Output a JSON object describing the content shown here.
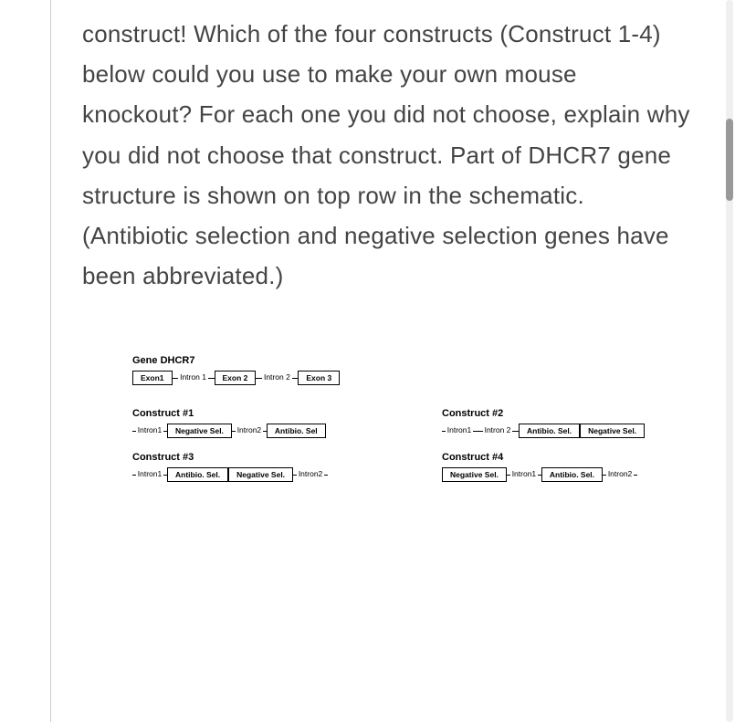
{
  "question": "construct!  Which of the four constructs (Construct 1-4) below could you use to make your own mouse knockout?  For each one you did not choose, explain why you did not choose that construct.  Part of DHCR7 gene structure is shown on top row in the schematic. (Antibiotic selection and negative selection genes have been abbreviated.)",
  "gene": {
    "title": "Gene DHCR7",
    "segments": [
      {
        "type": "exon",
        "label": "Exon1"
      },
      {
        "type": "intron",
        "label": "Intron 1"
      },
      {
        "type": "exon",
        "label": "Exon 2"
      },
      {
        "type": "intron",
        "label": "Intron 2"
      },
      {
        "type": "exon",
        "label": "Exon 3"
      }
    ]
  },
  "constructs": [
    {
      "title": "Construct #1",
      "segments": [
        {
          "type": "intron",
          "label": "Intron1"
        },
        {
          "type": "exon",
          "label": "Negative Sel."
        },
        {
          "type": "intron",
          "label": "Intron2"
        },
        {
          "type": "exon",
          "label": "Antibio. Sel"
        }
      ]
    },
    {
      "title": "Construct #2",
      "segments": [
        {
          "type": "intron",
          "label": "Intron1"
        },
        {
          "type": "intron",
          "label": "Intron 2"
        },
        {
          "type": "exon",
          "label": "Antibio. Sel."
        },
        {
          "type": "exon",
          "label": "Negative Sel."
        }
      ]
    },
    {
      "title": "Construct #3",
      "segments": [
        {
          "type": "intron",
          "label": "Intron1"
        },
        {
          "type": "exon",
          "label": "Antibio. Sel."
        },
        {
          "type": "exon",
          "label": "Negative Sel."
        },
        {
          "type": "intron",
          "label": "Intron2"
        }
      ]
    },
    {
      "title": "Construct #4",
      "segments": [
        {
          "type": "exon",
          "label": "Negative Sel."
        },
        {
          "type": "intron",
          "label": "Intron1"
        },
        {
          "type": "exon",
          "label": "Antibio. Sel."
        },
        {
          "type": "intron",
          "label": "Intron2"
        }
      ]
    }
  ]
}
